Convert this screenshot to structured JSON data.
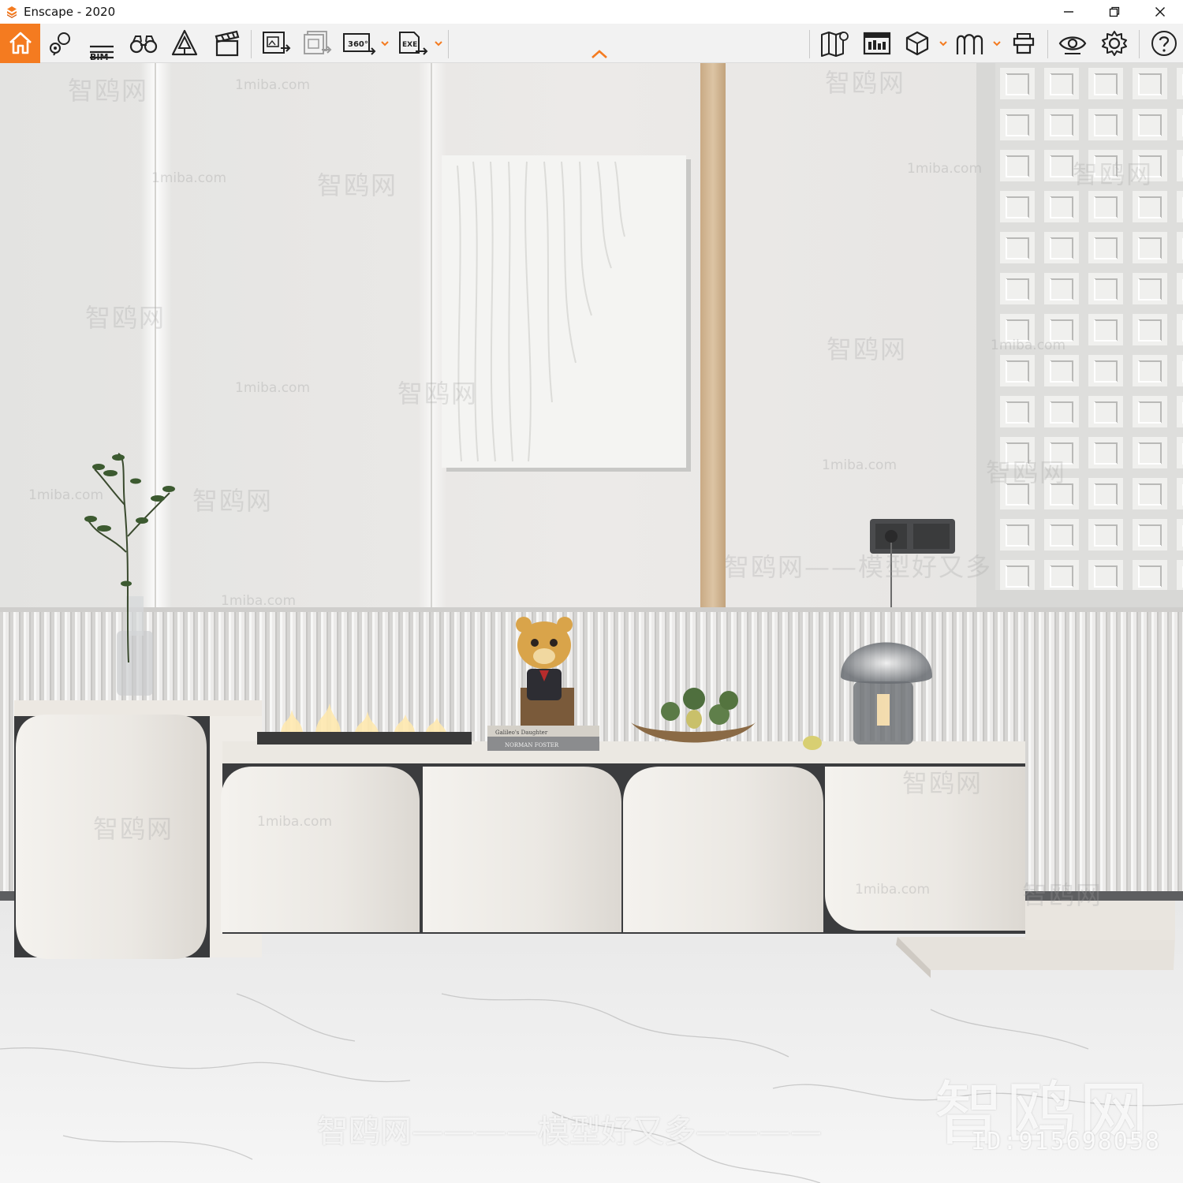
{
  "window": {
    "title": "Enscape - 2020",
    "minimize_icon": "minimize-icon",
    "restore_icon": "restore-icon",
    "close_icon": "close-icon"
  },
  "toolbar": {
    "bim_label": "BIM",
    "panorama_label": "360°",
    "exe_label": "EXE",
    "accent_color": "#f47b20"
  },
  "watermarks": {
    "site": "1miba.com",
    "brand_cn": "智鸥网",
    "slogan_cn": "智鸥网——模型好又多",
    "bottom_cn": "智鸥网————模型好又多————",
    "big_brand": "智鸥网",
    "id_text": "ID:915698058"
  },
  "scene": {
    "book_line1": "Galileo's Daughter",
    "book_line2": "NORMAN FOSTER"
  }
}
